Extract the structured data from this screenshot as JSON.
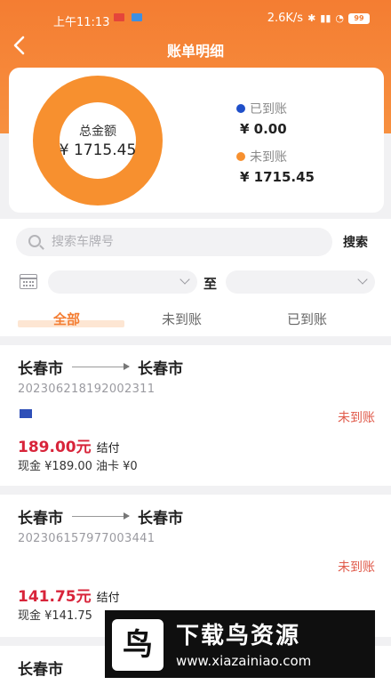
{
  "status_bar": {
    "time": "上午11:13",
    "network_speed": "2.6K/s",
    "battery": "99"
  },
  "header": {
    "title": "账单明细"
  },
  "summary": {
    "total_label": "总金额",
    "total_value": "¥ 1715.45",
    "received_label": "已到账",
    "received_value": "¥ 0.00",
    "pending_label": "未到账",
    "pending_value": "¥ 1715.45",
    "colors": {
      "received": "#1f4fc9",
      "pending": "#f7902f"
    }
  },
  "search": {
    "placeholder": "搜索车牌号",
    "button_label": "搜索"
  },
  "date_filter": {
    "to_label": "至"
  },
  "tabs": [
    {
      "label": "全部",
      "active": true
    },
    {
      "label": "未到账",
      "active": false
    },
    {
      "label": "已到账",
      "active": false
    }
  ],
  "records": [
    {
      "from": "长春市",
      "to": "长春市",
      "order_no": "20230621819200231​1",
      "status": "未到账",
      "amount": "189.00元",
      "settle": "结付",
      "detail": "现金 ¥189.00  油卡 ¥0"
    },
    {
      "from": "长春市",
      "to": "长春市",
      "order_no": "202306157977003441",
      "status": "未到账",
      "amount": "141.75元",
      "settle": "结付",
      "detail": "现金 ¥141.75"
    },
    {
      "from": "长春市",
      "to": ""
    }
  ],
  "watermark": {
    "logo_char": "鸟",
    "title": "下载鸟资源",
    "url": "www.xiazainiao.com"
  }
}
